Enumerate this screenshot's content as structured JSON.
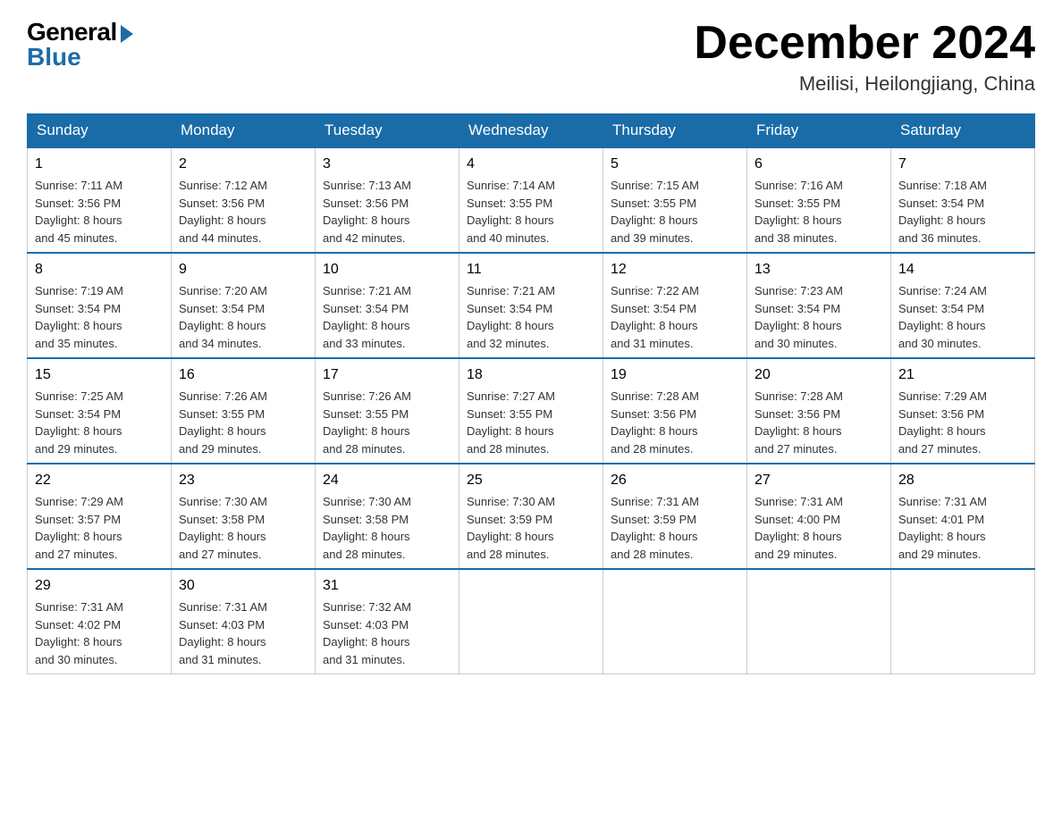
{
  "logo": {
    "general": "General",
    "blue": "Blue"
  },
  "header": {
    "month": "December 2024",
    "location": "Meilisi, Heilongjiang, China"
  },
  "weekdays": [
    "Sunday",
    "Monday",
    "Tuesday",
    "Wednesday",
    "Thursday",
    "Friday",
    "Saturday"
  ],
  "weeks": [
    [
      {
        "day": 1,
        "sunrise": "7:11 AM",
        "sunset": "3:56 PM",
        "daylight": "8 hours and 45 minutes."
      },
      {
        "day": 2,
        "sunrise": "7:12 AM",
        "sunset": "3:56 PM",
        "daylight": "8 hours and 44 minutes."
      },
      {
        "day": 3,
        "sunrise": "7:13 AM",
        "sunset": "3:56 PM",
        "daylight": "8 hours and 42 minutes."
      },
      {
        "day": 4,
        "sunrise": "7:14 AM",
        "sunset": "3:55 PM",
        "daylight": "8 hours and 40 minutes."
      },
      {
        "day": 5,
        "sunrise": "7:15 AM",
        "sunset": "3:55 PM",
        "daylight": "8 hours and 39 minutes."
      },
      {
        "day": 6,
        "sunrise": "7:16 AM",
        "sunset": "3:55 PM",
        "daylight": "8 hours and 38 minutes."
      },
      {
        "day": 7,
        "sunrise": "7:18 AM",
        "sunset": "3:54 PM",
        "daylight": "8 hours and 36 minutes."
      }
    ],
    [
      {
        "day": 8,
        "sunrise": "7:19 AM",
        "sunset": "3:54 PM",
        "daylight": "8 hours and 35 minutes."
      },
      {
        "day": 9,
        "sunrise": "7:20 AM",
        "sunset": "3:54 PM",
        "daylight": "8 hours and 34 minutes."
      },
      {
        "day": 10,
        "sunrise": "7:21 AM",
        "sunset": "3:54 PM",
        "daylight": "8 hours and 33 minutes."
      },
      {
        "day": 11,
        "sunrise": "7:21 AM",
        "sunset": "3:54 PM",
        "daylight": "8 hours and 32 minutes."
      },
      {
        "day": 12,
        "sunrise": "7:22 AM",
        "sunset": "3:54 PM",
        "daylight": "8 hours and 31 minutes."
      },
      {
        "day": 13,
        "sunrise": "7:23 AM",
        "sunset": "3:54 PM",
        "daylight": "8 hours and 30 minutes."
      },
      {
        "day": 14,
        "sunrise": "7:24 AM",
        "sunset": "3:54 PM",
        "daylight": "8 hours and 30 minutes."
      }
    ],
    [
      {
        "day": 15,
        "sunrise": "7:25 AM",
        "sunset": "3:54 PM",
        "daylight": "8 hours and 29 minutes."
      },
      {
        "day": 16,
        "sunrise": "7:26 AM",
        "sunset": "3:55 PM",
        "daylight": "8 hours and 29 minutes."
      },
      {
        "day": 17,
        "sunrise": "7:26 AM",
        "sunset": "3:55 PM",
        "daylight": "8 hours and 28 minutes."
      },
      {
        "day": 18,
        "sunrise": "7:27 AM",
        "sunset": "3:55 PM",
        "daylight": "8 hours and 28 minutes."
      },
      {
        "day": 19,
        "sunrise": "7:28 AM",
        "sunset": "3:56 PM",
        "daylight": "8 hours and 28 minutes."
      },
      {
        "day": 20,
        "sunrise": "7:28 AM",
        "sunset": "3:56 PM",
        "daylight": "8 hours and 27 minutes."
      },
      {
        "day": 21,
        "sunrise": "7:29 AM",
        "sunset": "3:56 PM",
        "daylight": "8 hours and 27 minutes."
      }
    ],
    [
      {
        "day": 22,
        "sunrise": "7:29 AM",
        "sunset": "3:57 PM",
        "daylight": "8 hours and 27 minutes."
      },
      {
        "day": 23,
        "sunrise": "7:30 AM",
        "sunset": "3:58 PM",
        "daylight": "8 hours and 27 minutes."
      },
      {
        "day": 24,
        "sunrise": "7:30 AM",
        "sunset": "3:58 PM",
        "daylight": "8 hours and 28 minutes."
      },
      {
        "day": 25,
        "sunrise": "7:30 AM",
        "sunset": "3:59 PM",
        "daylight": "8 hours and 28 minutes."
      },
      {
        "day": 26,
        "sunrise": "7:31 AM",
        "sunset": "3:59 PM",
        "daylight": "8 hours and 28 minutes."
      },
      {
        "day": 27,
        "sunrise": "7:31 AM",
        "sunset": "4:00 PM",
        "daylight": "8 hours and 29 minutes."
      },
      {
        "day": 28,
        "sunrise": "7:31 AM",
        "sunset": "4:01 PM",
        "daylight": "8 hours and 29 minutes."
      }
    ],
    [
      {
        "day": 29,
        "sunrise": "7:31 AM",
        "sunset": "4:02 PM",
        "daylight": "8 hours and 30 minutes."
      },
      {
        "day": 30,
        "sunrise": "7:31 AM",
        "sunset": "4:03 PM",
        "daylight": "8 hours and 31 minutes."
      },
      {
        "day": 31,
        "sunrise": "7:32 AM",
        "sunset": "4:03 PM",
        "daylight": "8 hours and 31 minutes."
      },
      null,
      null,
      null,
      null
    ]
  ],
  "labels": {
    "sunrise": "Sunrise:",
    "sunset": "Sunset:",
    "daylight": "Daylight:"
  }
}
